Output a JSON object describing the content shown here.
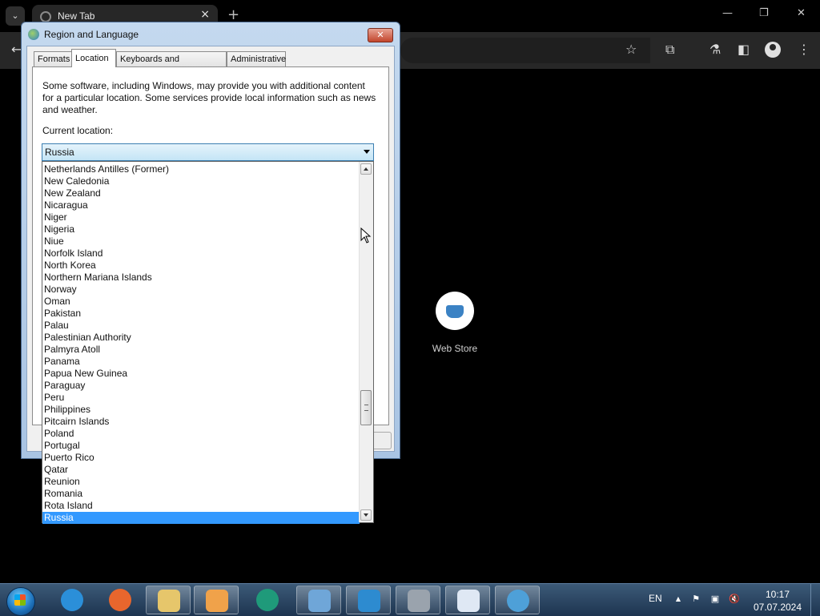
{
  "browser": {
    "tab_title": "New Tab",
    "tab_close": "×",
    "new_tab": "+",
    "tab_search_glyph": "⌄",
    "window_controls": [
      "—",
      "❐",
      "✕"
    ],
    "toolbar_icons": {
      "bookmark": "☆",
      "extensions": "⧉",
      "labs": "⚗",
      "sidepanel": "◧",
      "menu": "⋮",
      "back": "←"
    },
    "shortcut_label": "Web Store"
  },
  "dialog": {
    "title": "Region and Language",
    "close_glyph": "✕",
    "tabs": [
      {
        "label": "Formats"
      },
      {
        "label": "Location"
      },
      {
        "label": "Keyboards and Languages"
      },
      {
        "label": "Administrative"
      }
    ],
    "active_tab": "Location",
    "intro_text": "Some software, including Windows, may provide you with additional content for a particular location. Some services provide local information such as news and weather.",
    "current_location_label": "Current location:",
    "current_location_value": "Russia",
    "dropdown_items": [
      "Netherlands Antilles (Former)",
      "New Caledonia",
      "New Zealand",
      "Nicaragua",
      "Niger",
      "Nigeria",
      "Niue",
      "Norfolk Island",
      "North Korea",
      "Northern Mariana Islands",
      "Norway",
      "Oman",
      "Pakistan",
      "Palau",
      "Palestinian Authority",
      "Palmyra Atoll",
      "Panama",
      "Papua New Guinea",
      "Paraguay",
      "Peru",
      "Philippines",
      "Pitcairn Islands",
      "Poland",
      "Portugal",
      "Puerto Rico",
      "Qatar",
      "Reunion",
      "Romania",
      "Rota Island",
      "Russia"
    ],
    "selected_item": "Russia"
  },
  "taskbar": {
    "apps": [
      {
        "name": "internet-explorer",
        "color": "#2b8fd9"
      },
      {
        "name": "firefox",
        "color": "#e8662d"
      },
      {
        "name": "windows-explorer",
        "color": "#e6c66b"
      },
      {
        "name": "media-player",
        "color": "#f0a24a"
      },
      {
        "name": "app-green",
        "color": "#1f9a7a"
      },
      {
        "name": "control-panel",
        "color": "#6fa6d8"
      },
      {
        "name": "remote-app",
        "color": "#2d8bd0"
      },
      {
        "name": "recycle-tool",
        "color": "#9aa3ad"
      },
      {
        "name": "document-app",
        "color": "#dfe8f4"
      },
      {
        "name": "region-globe",
        "color": "#4ea0d8"
      }
    ],
    "tray_language": "EN",
    "tray_icons": {
      "up_arrow": "▲",
      "flag": "⚑",
      "network": "▣",
      "volume": "🔇"
    },
    "clock_time": "10:17",
    "clock_date": "07.07.2024"
  }
}
